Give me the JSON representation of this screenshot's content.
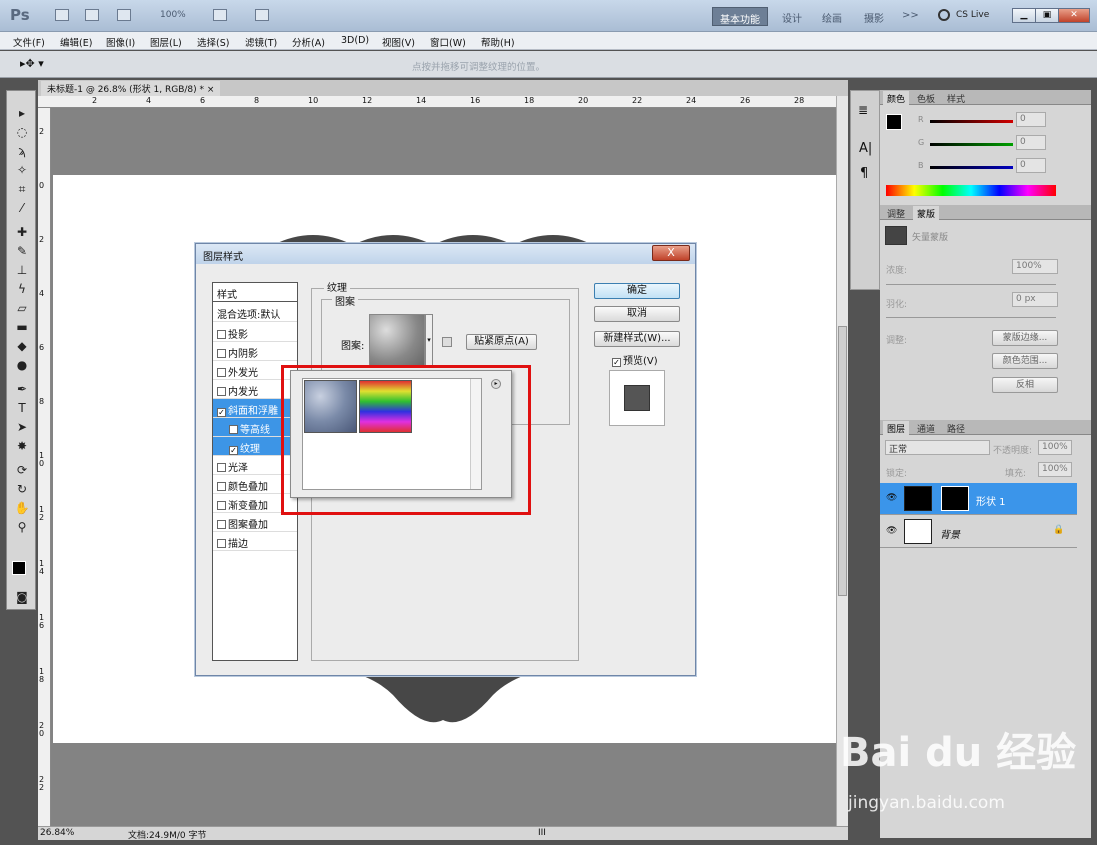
{
  "app": {
    "logo": "Ps",
    "zoom": "100%",
    "workspaces": [
      "基本功能",
      "设计",
      "绘画",
      "摄影"
    ],
    "more": ">>",
    "cslive": "CS Live",
    "cslive_arrow": "▾",
    "mb": "Mb",
    "br": "Br"
  },
  "menu": [
    "文件(F)",
    "编辑(E)",
    "图像(I)",
    "图层(L)",
    "选择(S)",
    "滤镜(T)",
    "分析(A)",
    "3D(D)",
    "视图(V)",
    "窗口(W)",
    "帮助(H)"
  ],
  "options": {
    "hint": "点按并拖移可调整纹理的位置。"
  },
  "document": {
    "tab": "未标题-1 @ 26.8% (形状 1, RGB/8) * ×",
    "ruler_top": [
      "2",
      "4",
      "6",
      "8",
      "10",
      "12",
      "14",
      "16",
      "18",
      "20",
      "22",
      "24",
      "26",
      "28"
    ],
    "ruler_left": [
      "2",
      "0",
      "2",
      "4",
      "6",
      "8",
      "1 0",
      "1 2",
      "1 4",
      "1 6",
      "1 8",
      "2 0",
      "2 2"
    ]
  },
  "status": {
    "zoom": "26.84%",
    "doc": "文档:24.9M/0 字节",
    "scroll_mark": "III"
  },
  "dialog": {
    "title": "图层样式",
    "close": "X",
    "styles_header": "样式",
    "blend": "混合选项:默认",
    "items": [
      {
        "label": "投影",
        "checked": false
      },
      {
        "label": "内阴影",
        "checked": false
      },
      {
        "label": "外发光",
        "checked": false
      },
      {
        "label": "内发光",
        "checked": false
      },
      {
        "label": "斜面和浮雕",
        "checked": true
      },
      {
        "label": "等高线",
        "checked": false,
        "sub": true
      },
      {
        "label": "纹理",
        "checked": true,
        "sub": true
      },
      {
        "label": "光泽",
        "checked": false
      },
      {
        "label": "颜色叠加",
        "checked": false
      },
      {
        "label": "渐变叠加",
        "checked": false
      },
      {
        "label": "图案叠加",
        "checked": false
      },
      {
        "label": "描边",
        "checked": false
      }
    ],
    "check_mark": "✓",
    "texture_legend": "纹理",
    "pattern_legend": "图案",
    "pattern_label": "图案:",
    "snap_button": "贴紧原点(A)",
    "ok": "确定",
    "cancel": "取消",
    "new_style": "新建样式(W)...",
    "preview": "预览(V)"
  },
  "right": {
    "color_tabs": [
      "颜色",
      "色板",
      "样式"
    ],
    "rgb": [
      {
        "ch": "R",
        "val": "0",
        "color": "#d00000"
      },
      {
        "ch": "G",
        "val": "0",
        "color": "#00a000"
      },
      {
        "ch": "B",
        "val": "0",
        "color": "#0000c0"
      }
    ],
    "adjust_tabs": [
      "调整",
      "蒙版"
    ],
    "mask": {
      "label": "矢量蒙版",
      "density_label": "浓度:",
      "density": "100%",
      "feather_label": "羽化:",
      "feather": "0 px",
      "refine_label": "调整:",
      "buttons": [
        "蒙版边缘...",
        "颜色范围...",
        "反相"
      ]
    },
    "layer_tabs": [
      "图层",
      "通道",
      "路径"
    ],
    "blend_mode": "正常",
    "opacity_label": "不透明度:",
    "opacity": "100%",
    "lock_label": "锁定:",
    "fill_label": "填充:",
    "fill": "100%",
    "layers": [
      {
        "name": "形状 1",
        "selected": true
      },
      {
        "name": "背景",
        "selected": false
      }
    ],
    "lock_icon": "🔒"
  },
  "watermark": {
    "main": "Bai du 经验",
    "url": "jingyan.baidu.com"
  }
}
